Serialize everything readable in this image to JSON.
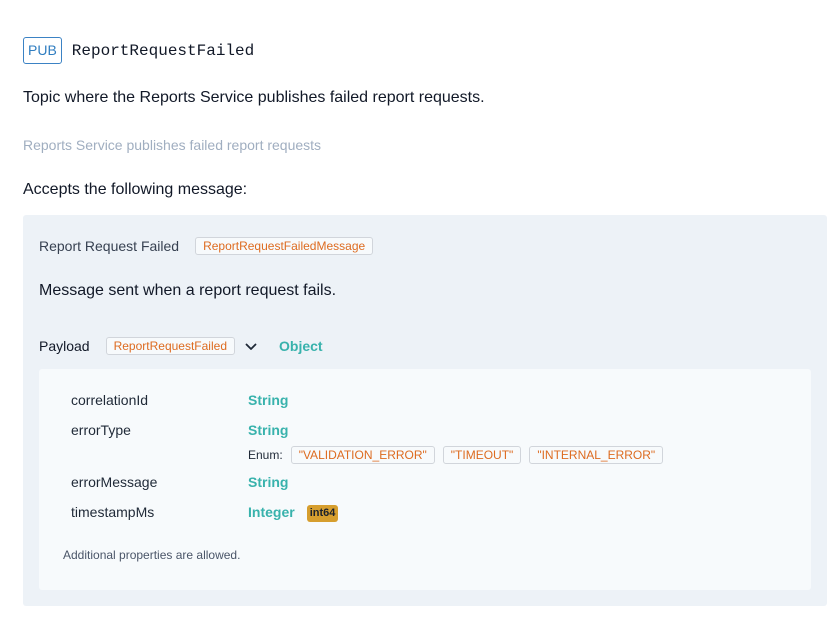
{
  "channel": {
    "operation_badge": "PUB",
    "name": "ReportRequestFailed",
    "description": "Topic where the Reports Service publishes failed report requests.",
    "summary": "Reports Service publishes failed report requests"
  },
  "accepts_label": "Accepts the following message:",
  "message": {
    "title": "Report Request Failed",
    "id_tag": "ReportRequestFailedMessage",
    "description": "Message sent when a report request fails.",
    "payload": {
      "label": "Payload",
      "schema_tag": "ReportRequestFailed",
      "type": "Object",
      "expand_icon": "chevron-down-icon",
      "properties": [
        {
          "name": "correlationId",
          "type": "String"
        },
        {
          "name": "errorType",
          "type": "String",
          "enum_label": "Enum:",
          "enum": [
            "\"VALIDATION_ERROR\"",
            "\"TIMEOUT\"",
            "\"INTERNAL_ERROR\""
          ]
        },
        {
          "name": "errorMessage",
          "type": "String"
        },
        {
          "name": "timestampMs",
          "type": "Integer",
          "format": "int64"
        }
      ],
      "additional_properties": "Additional properties are allowed."
    }
  },
  "colors": {
    "pub_badge": "#2f7dc0",
    "type_teal": "#38b2ac",
    "tag_orange": "#dd6b20",
    "format_badge_bg": "#d69e2e",
    "panel_bg": "#edf2f7",
    "props_bg": "#f7fafc"
  }
}
